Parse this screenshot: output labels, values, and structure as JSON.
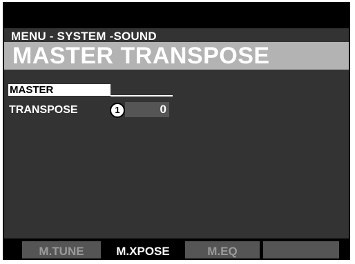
{
  "header": {
    "breadcrumb": "MENU - SYSTEM -SOUND",
    "title": "MASTER TRANSPOSE"
  },
  "section": {
    "header": "MASTER",
    "param_label": "TRANSPOSE",
    "callout": "1",
    "value": "0"
  },
  "tabs": [
    {
      "label": "M.TUNE",
      "active": false
    },
    {
      "label": "M.XPOSE",
      "active": true
    },
    {
      "label": "M.EQ",
      "active": false
    }
  ],
  "colors": {
    "background": "#333333",
    "title_bar": "#b3b3b3",
    "tab_inactive": "#555555",
    "text": "#ffffff"
  }
}
